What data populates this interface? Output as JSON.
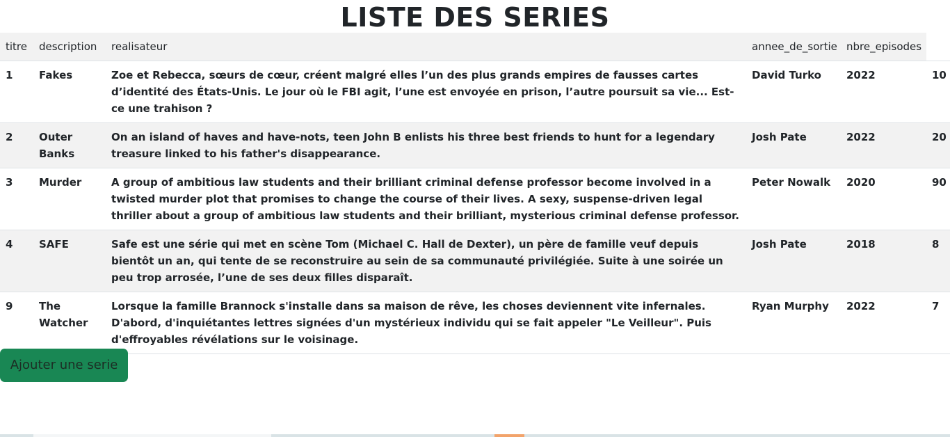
{
  "page": {
    "title": "LISTE DES SERIES"
  },
  "table": {
    "headers": [
      "titre",
      "description",
      "realisateur",
      "annee_de_sortie",
      "nbre_episodes",
      ""
    ],
    "rows": [
      {
        "id": "1",
        "titre": "Fakes",
        "description": "Zoe et Rebecca, sœurs de cœur, créent malgré elles l’un des plus grands empires de fausses cartes d’identité des États-Unis. Le jour où le FBI agit, l’une est envoyée en prison, l’autre poursuit sa vie... Est-ce une trahison ?",
        "realisateur": "David Turko",
        "annee": "2022",
        "episodes": "10"
      },
      {
        "id": "2",
        "titre": "Outer Banks",
        "description": "On an island of haves and have-nots, teen John B enlists his three best friends to hunt for a legendary treasure linked to his father's disappearance.",
        "realisateur": "Josh Pate",
        "annee": "2022",
        "episodes": "20"
      },
      {
        "id": "3",
        "titre": "Murder",
        "description": "A group of ambitious law students and their brilliant criminal defense professor become involved in a twisted murder plot that promises to change the course of their lives. A sexy, suspense-driven legal thriller about a group of ambitious law students and their brilliant, mysterious criminal defense professor.",
        "realisateur": "Peter Nowalk",
        "annee": "2020",
        "episodes": "90"
      },
      {
        "id": "4",
        "titre": "SAFE",
        "description": "Safe est une série qui met en scène Tom (Michael C. Hall de Dexter), un père de famille veuf depuis bientôt un an, qui tente de se reconstruire au sein de sa communauté privilégiée. Suite à une soirée un peu trop arrosée, l’une de ses deux filles disparaît.",
        "realisateur": "Josh Pate",
        "annee": "2018",
        "episodes": "8"
      },
      {
        "id": "9",
        "titre": "The Watcher",
        "description": "Lorsque la famille Brannock s'installe dans sa maison de rêve, les choses deviennent vite infernales. D'abord, d'inquiétantes lettres signées d'un mystérieux individu qui se fait appeler \"Le Veilleur\". Puis d'effroyables révélations sur le voisinage.",
        "realisateur": "Ryan Murphy",
        "annee": "2022",
        "episodes": "7"
      }
    ]
  },
  "actions": {
    "add_label": "Ajouter une serie"
  },
  "colors": {
    "header_bg": "#f2f2f2",
    "stripe_bg": "#f2f2f2",
    "button_bg": "#198754",
    "text": "#212529"
  }
}
